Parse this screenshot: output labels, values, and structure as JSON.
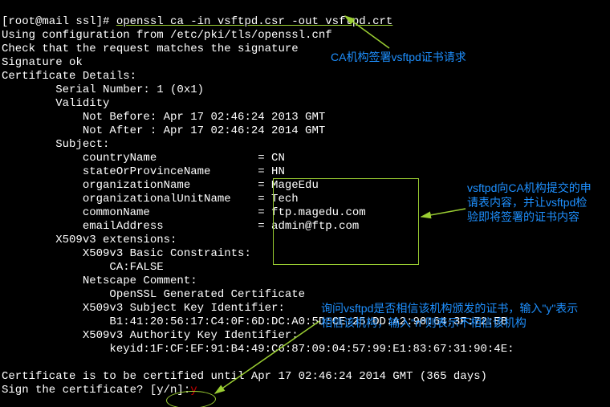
{
  "prompt": "[root@mail ssl]# ",
  "command": "openssl ca -in vsftpd.csr -out vsftpd.crt",
  "lines": {
    "l1": "Using configuration from /etc/pki/tls/openssl.cnf",
    "l2": "Check that the request matches the signature",
    "l3": "Signature ok",
    "l4": "Certificate Details:",
    "l5": "        Serial Number: 1 (0x1)",
    "l6": "        Validity",
    "l7": "            Not Before: Apr 17 02:46:24 2013 GMT",
    "l8": "            Not After : Apr 17 02:46:24 2014 GMT",
    "l9": "        Subject:",
    "l10": "            countryName               = CN",
    "l11": "            stateOrProvinceName       = HN",
    "l12": "            organizationName          = MageEdu",
    "l13": "            organizationalUnitName    = Tech",
    "l14": "            commonName                = ftp.magedu.com",
    "l15": "            emailAddress              = admin@ftp.com",
    "l16": "        X509v3 extensions:",
    "l17": "            X509v3 Basic Constraints: ",
    "l18": "                CA:FALSE",
    "l19": "            Netscape Comment: ",
    "l20": "                OpenSSL Generated Certificate",
    "l21": "            X509v3 Subject Key Identifier: ",
    "l22": "                B1:41:20:56:17:C4:0F:6D:DC:A0:5D:CE:25:DD:A2:90:64:3F:72:EB",
    "l23": "            X509v3 Authority Key Identifier: ",
    "l24": "                keyid:1F:CF:EF:91:B4:49:C6:87:09:04:57:99:E1:83:67:31:90:4E:",
    "l25": "Certificate is to be certified until Apr 17 02:46:24 2014 GMT (365 days)",
    "l26a": "Sign the certificate? [y/n]:",
    "l26b": "y"
  },
  "annotations": {
    "a1": "CA机构签署vsftpd证书请求",
    "a2": "vsftpd向CA机构提交的申请表内容，并让vsftpd检验即将签署的证书内容",
    "a3": "询问vsftpd是否相信该机构颁发的证书，输入\"y\"表示相信该机构，输入\"n\"则表示不相信该机构"
  }
}
